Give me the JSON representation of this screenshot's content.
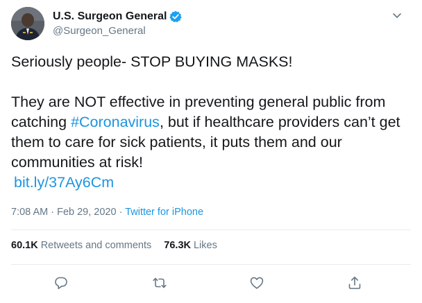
{
  "header": {
    "display_name": "U.S. Surgeon General",
    "handle": "@Surgeon_General",
    "icons": {
      "avatar": "profile-photo",
      "verified": "verified-badge-icon",
      "more": "chevron-down-icon"
    }
  },
  "tweet": {
    "line1": "Seriously people- STOP BUYING MASKS!",
    "line2_before": "They are NOT effective in preventing general public from catching ",
    "hashtag": "#Coronavirus",
    "line2_after": ", but if healthcare providers can’t get them to care for sick patients, it puts them and our communities at risk!",
    "link": "bit.ly/37Ay6Cm"
  },
  "meta": {
    "time": "7:08 AM",
    "separator1": " · ",
    "date": "Feb 29, 2020",
    "separator2": " · ",
    "source": "Twitter for iPhone"
  },
  "stats": {
    "retweets_count": "60.1K",
    "retweets_label": "Retweets and comments",
    "likes_count": "76.3K",
    "likes_label": "Likes"
  },
  "actions": {
    "reply": "reply-icon",
    "retweet": "retweet-icon",
    "like": "heart-icon",
    "share": "share-icon"
  },
  "colors": {
    "link": "#1b95e0",
    "text": "#14171a",
    "muted": "#657786",
    "divider": "#e6ecf0"
  }
}
